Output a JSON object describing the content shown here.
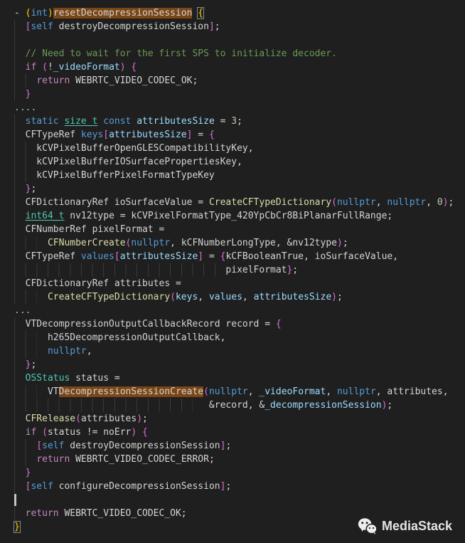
{
  "editor": {
    "bg": "#1f1f1f",
    "guide_color": "#3a3a3a",
    "highlight_bg": "#7a4616",
    "caret_color": "#c4c4c4",
    "palette": {
      "d": "#d4d4d4",
      "k": "#C586C0",
      "b": "#569CD6",
      "t": "#4EC9B0",
      "f": "#DCDCAA",
      "v": "#9CDCFE",
      "n": "#B5CEA8",
      "c": "#6A9955",
      "g1": "#FFD700",
      "g2": "#DA70D6",
      "dim": "#a9b2bc"
    },
    "lines": [
      {
        "guides": 0,
        "segs": [
          [
            "- ",
            "d"
          ],
          [
            "(",
            "g1"
          ],
          [
            "int",
            "b"
          ],
          [
            ")",
            "g1"
          ],
          [
            "resetDecompressionSession",
            "d",
            "hl"
          ],
          [
            " ",
            "d"
          ],
          [
            "{",
            "g1",
            "box"
          ]
        ]
      },
      {
        "guides": 1,
        "segs": [
          [
            "  ",
            "d"
          ],
          [
            "[",
            "g2"
          ],
          [
            "self",
            "b"
          ],
          [
            " destroyDecompressionSession",
            "d"
          ],
          [
            "]",
            "g2"
          ],
          [
            ";",
            "d"
          ]
        ]
      },
      {
        "guides": 1,
        "segs": []
      },
      {
        "guides": 1,
        "segs": [
          [
            "  ",
            "d"
          ],
          [
            "// Need to wait for the first SPS to initialize decoder.",
            "c"
          ]
        ]
      },
      {
        "guides": 1,
        "segs": [
          [
            "  ",
            "d"
          ],
          [
            "if",
            "k"
          ],
          [
            " ",
            "d"
          ],
          [
            "(",
            "g2"
          ],
          [
            "!",
            "d"
          ],
          [
            "_videoFormat",
            "v"
          ],
          [
            ")",
            "g2"
          ],
          [
            " ",
            "d"
          ],
          [
            "{",
            "g2"
          ]
        ]
      },
      {
        "guides": 2,
        "segs": [
          [
            "    ",
            "d"
          ],
          [
            "return",
            "k"
          ],
          [
            " WEBRTC_VIDEO_CODEC_OK;",
            "d"
          ]
        ]
      },
      {
        "guides": 1,
        "segs": [
          [
            "  ",
            "d"
          ],
          [
            "}",
            "g2"
          ]
        ]
      },
      {
        "guides": 0,
        "segs": [
          [
            "....",
            "dim"
          ]
        ]
      },
      {
        "guides": 1,
        "segs": [
          [
            "  ",
            "d"
          ],
          [
            "static",
            "b"
          ],
          [
            " ",
            "d"
          ],
          [
            "size_t",
            "t",
            "u"
          ],
          [
            " ",
            "d"
          ],
          [
            "const",
            "b"
          ],
          [
            " ",
            "d"
          ],
          [
            "attributesSize",
            "v"
          ],
          [
            " = ",
            "d"
          ],
          [
            "3",
            "n"
          ],
          [
            ";",
            "d"
          ]
        ]
      },
      {
        "guides": 1,
        "segs": [
          [
            "  CFTypeRef ",
            "d"
          ],
          [
            "keys",
            "b"
          ],
          [
            "[",
            "g2"
          ],
          [
            "attributesSize",
            "v"
          ],
          [
            "]",
            "g2"
          ],
          [
            " = ",
            "d"
          ],
          [
            "{",
            "g2"
          ]
        ]
      },
      {
        "guides": 2,
        "segs": [
          [
            "    kCVPixelBufferOpenGLESCompatibilityKey,",
            "d"
          ]
        ]
      },
      {
        "guides": 2,
        "segs": [
          [
            "    kCVPixelBufferIOSurfacePropertiesKey,",
            "d"
          ]
        ]
      },
      {
        "guides": 2,
        "segs": [
          [
            "    kCVPixelBufferPixelFormatTypeKey",
            "d"
          ]
        ]
      },
      {
        "guides": 1,
        "segs": [
          [
            "  ",
            "d"
          ],
          [
            "}",
            "g2"
          ],
          [
            ";",
            "d"
          ]
        ]
      },
      {
        "guides": 1,
        "segs": [
          [
            "  CFDictionaryRef ioSurfaceValue = ",
            "d"
          ],
          [
            "CreateCFTypeDictionary",
            "f"
          ],
          [
            "(",
            "g2"
          ],
          [
            "nullptr",
            "b"
          ],
          [
            ", ",
            "d"
          ],
          [
            "nullptr",
            "b"
          ],
          [
            ", ",
            "d"
          ],
          [
            "0",
            "n"
          ],
          [
            ")",
            "g2"
          ],
          [
            ";",
            "d"
          ]
        ]
      },
      {
        "guides": 1,
        "segs": [
          [
            "  ",
            "d"
          ],
          [
            "int64_t",
            "t",
            "u"
          ],
          [
            " nv12type = kCVPixelFormatType_420YpCbCr8BiPlanarFullRange;",
            "d"
          ]
        ]
      },
      {
        "guides": 1,
        "segs": [
          [
            "  CFNumberRef pixelFormat =",
            "d"
          ]
        ]
      },
      {
        "guides": 3,
        "segs": [
          [
            "      ",
            "d"
          ],
          [
            "CFNumberCreate",
            "f"
          ],
          [
            "(",
            "g2"
          ],
          [
            "nullptr",
            "b"
          ],
          [
            ", kCFNumberLongType, &nv12type",
            "d"
          ],
          [
            ")",
            "g2"
          ],
          [
            ";",
            "d"
          ]
        ]
      },
      {
        "guides": 1,
        "segs": [
          [
            "  CFTypeRef ",
            "d"
          ],
          [
            "values",
            "b"
          ],
          [
            "[",
            "g2"
          ],
          [
            "attributesSize",
            "v"
          ],
          [
            "]",
            "g2"
          ],
          [
            " = ",
            "d"
          ],
          [
            "{",
            "g2"
          ],
          [
            "kCFBooleanTrue, ioSurfaceValue,",
            "d"
          ]
        ]
      },
      {
        "guides": 19,
        "segs": [
          [
            "                                      pixelFormat",
            "d"
          ],
          [
            "}",
            "g2"
          ],
          [
            ";",
            "d"
          ]
        ]
      },
      {
        "guides": 1,
        "segs": [
          [
            "  CFDictionaryRef attributes =",
            "d"
          ]
        ]
      },
      {
        "guides": 3,
        "segs": [
          [
            "      ",
            "d"
          ],
          [
            "CreateCFTypeDictionary",
            "f"
          ],
          [
            "(",
            "g2"
          ],
          [
            "keys",
            "v"
          ],
          [
            ", ",
            "d"
          ],
          [
            "values",
            "v"
          ],
          [
            ", ",
            "d"
          ],
          [
            "attributesSize",
            "v"
          ],
          [
            ")",
            "g2"
          ],
          [
            ";",
            "d"
          ]
        ]
      },
      {
        "guides": 0,
        "segs": [
          [
            "...",
            "dim"
          ]
        ]
      },
      {
        "guides": 1,
        "segs": [
          [
            "  VTDecompressionOutputCallbackRecord record = ",
            "d"
          ],
          [
            "{",
            "g2"
          ]
        ]
      },
      {
        "guides": 3,
        "segs": [
          [
            "      h265DecompressionOutputCallback,",
            "d"
          ]
        ]
      },
      {
        "guides": 3,
        "segs": [
          [
            "      ",
            "d"
          ],
          [
            "nullptr",
            "b"
          ],
          [
            ",",
            "d"
          ]
        ]
      },
      {
        "guides": 1,
        "segs": [
          [
            "  ",
            "d"
          ],
          [
            "}",
            "g2"
          ],
          [
            ";",
            "d"
          ]
        ]
      },
      {
        "guides": 1,
        "segs": [
          [
            "  ",
            "d"
          ],
          [
            "OSStatus",
            "t"
          ],
          [
            " status =",
            "d"
          ]
        ]
      },
      {
        "guides": 3,
        "segs": [
          [
            "      ",
            "d"
          ],
          [
            "VT",
            "d"
          ],
          [
            "DecompressionSessionCreate",
            "d",
            "hl"
          ],
          [
            "(",
            "g2"
          ],
          [
            "nullptr",
            "b"
          ],
          [
            ", ",
            "d"
          ],
          [
            "_videoFormat",
            "v"
          ],
          [
            ", ",
            "d"
          ],
          [
            "nullptr",
            "b"
          ],
          [
            ", attributes,",
            "d"
          ]
        ]
      },
      {
        "guides": 17,
        "segs": [
          [
            "                                   &record, &",
            "d"
          ],
          [
            "_decompressionSession",
            "v"
          ],
          [
            ")",
            "g2"
          ],
          [
            ";",
            "d"
          ]
        ]
      },
      {
        "guides": 1,
        "segs": [
          [
            "  ",
            "d"
          ],
          [
            "CFRelease",
            "f"
          ],
          [
            "(",
            "g2"
          ],
          [
            "attributes",
            "d"
          ],
          [
            ")",
            "g2"
          ],
          [
            ";",
            "d"
          ]
        ]
      },
      {
        "guides": 1,
        "segs": [
          [
            "  ",
            "d"
          ],
          [
            "if",
            "k"
          ],
          [
            " ",
            "d"
          ],
          [
            "(",
            "g2"
          ],
          [
            "status != noErr",
            "d"
          ],
          [
            ")",
            "g2"
          ],
          [
            " ",
            "d"
          ],
          [
            "{",
            "g2"
          ]
        ]
      },
      {
        "guides": 2,
        "segs": [
          [
            "    ",
            "d"
          ],
          [
            "[",
            "g2"
          ],
          [
            "self",
            "b"
          ],
          [
            " destroyDecompressionSession",
            "d"
          ],
          [
            "]",
            "g2"
          ],
          [
            ";",
            "d"
          ]
        ]
      },
      {
        "guides": 2,
        "segs": [
          [
            "    ",
            "d"
          ],
          [
            "return",
            "k"
          ],
          [
            " WEBRTC_VIDEO_CODEC_ERROR;",
            "d"
          ]
        ]
      },
      {
        "guides": 1,
        "segs": [
          [
            "  ",
            "d"
          ],
          [
            "}",
            "g2"
          ]
        ]
      },
      {
        "guides": 1,
        "segs": [
          [
            "  ",
            "d"
          ],
          [
            "[",
            "g2"
          ],
          [
            "self",
            "b"
          ],
          [
            " configureDecompressionSession",
            "d"
          ],
          [
            "]",
            "g2"
          ],
          [
            ";",
            "d"
          ]
        ]
      },
      {
        "guides": 0,
        "caret": true,
        "segs": []
      },
      {
        "guides": 1,
        "segs": [
          [
            "  ",
            "d"
          ],
          [
            "return",
            "k"
          ],
          [
            " WEBRTC_VIDEO_CODEC_OK;",
            "d"
          ]
        ]
      },
      {
        "guides": 0,
        "segs": [
          [
            "}",
            "g1",
            "box"
          ]
        ]
      }
    ]
  },
  "watermark": {
    "label": "MediaStack",
    "icon": "wechat-icon"
  }
}
